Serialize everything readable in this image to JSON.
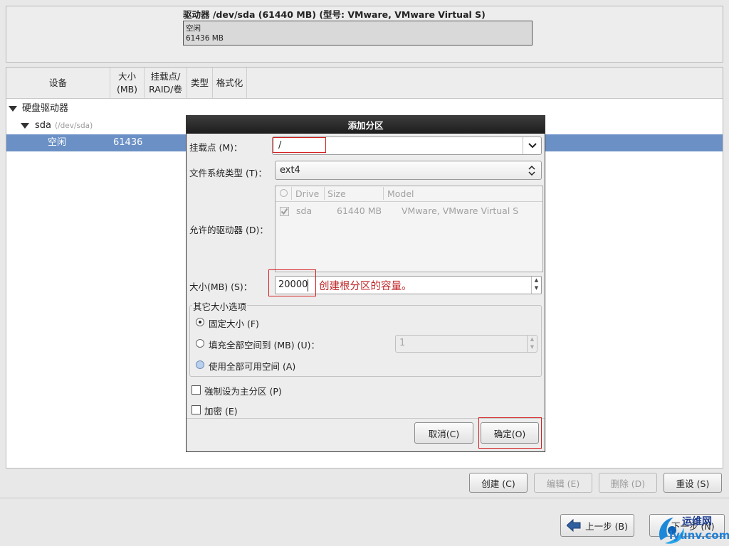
{
  "drive": {
    "title": "驱动器 /dev/sda (61440 MB) (型号: VMware, VMware Virtual S)",
    "bar_line1": "空闲",
    "bar_line2": "61436 MB"
  },
  "tree": {
    "columns": [
      "设备",
      "大小\n(MB)",
      "挂载点/\nRAID/卷",
      "类型",
      "格式化"
    ],
    "root_label": "硬盘驱动器",
    "disk_label": "sda",
    "disk_path": "(/dev/sda)",
    "free_row": {
      "device": "空闲",
      "size": "61436"
    }
  },
  "bottom_buttons": {
    "create": "创建 (C)",
    "edit": "编辑 (E)",
    "delete": "删除 (D)",
    "reset": "重设 (S)",
    "back": "上一步 (B)",
    "next": "下一步 (N)"
  },
  "dialog": {
    "title": "添加分区",
    "mount_label": "挂载点 (M)：",
    "mount_value": "/",
    "fs_label": "文件系统类型 (T)：",
    "fs_value": "ext4",
    "drives_label": "允许的驱动器 (D)：",
    "drive_table": {
      "headers": [
        "Drive",
        "Size",
        "Model"
      ],
      "rows": [
        {
          "drive": "sda",
          "size": "61440 MB",
          "model": "VMware, VMware Virtual S"
        }
      ]
    },
    "size_label": "大小(MB) (S)：",
    "size_value": "20000",
    "size_annotation": "创建根分区的容量。",
    "other_options_legend": "其它大小选项",
    "opt_fixed": "固定大小 (F)",
    "opt_fill_to": "填充全部空间到 (MB) (U)：",
    "opt_fill_to_value": "1",
    "opt_fill_all": "使用全部可用空间 (A)",
    "primary_label": "強制设为主分区 (P)",
    "encrypt_label": "加密 (E)",
    "cancel": "取消(C)",
    "ok": "确定(O)"
  },
  "watermark": {
    "name": "运维网",
    "url": "iyunv.com"
  },
  "colors": {
    "selection": "#6b90c6",
    "annotation_red": "#d42020",
    "dialog_title_bg": "#2a2a2a"
  }
}
